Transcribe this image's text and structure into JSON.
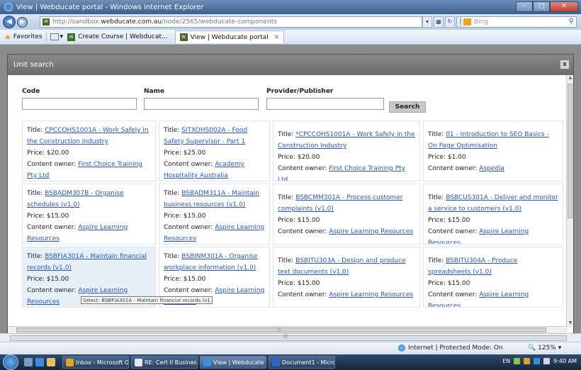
{
  "window": {
    "title": "View | Webducate portal - Windows Internet Explorer",
    "url_prefix": "http://sandbox.",
    "url_host": "webducate.com.au",
    "url_path": "/node/2565/webducate-components",
    "search_engine": "Bing"
  },
  "favorites": {
    "label": "Favorites",
    "tabs": [
      {
        "label": "Create Course | Webducat...",
        "active": false
      },
      {
        "label": "View | Webducate portal",
        "active": true
      }
    ]
  },
  "dialog": {
    "title": "Unit search",
    "close_label": "x",
    "form": {
      "code_label": "Code",
      "name_label": "Name",
      "provider_label": "Provider/Publisher",
      "code_value": "",
      "name_value": "",
      "provider_value": "",
      "search_label": "Search"
    },
    "field_labels": {
      "title": "Title: ",
      "price": "Price: ",
      "owner": "Content owner: "
    },
    "rows": [
      [
        {
          "title": "CPCCOHS1001A - Work Safely in the Construction Industry",
          "price": "$20.00",
          "owner": "First Choice Training Pty Ltd"
        },
        {
          "title": "SITXOHS002A - Food Safety Supervisor - Part 1",
          "price": "$25.00",
          "owner": "Academy Hospitality Australia"
        },
        {
          "title": "*CPCCOHS1001A - Work Safely in the Construction Industry",
          "price": "$20.00",
          "owner": "First Choice Training Pty Ltd"
        },
        {
          "title": "01 - Introduction to SEO Basics - On Page Optimisation",
          "price": "$1.00",
          "owner": "Aspedia"
        }
      ],
      [
        {
          "title": "BSBADM307B - Organise schedules (v1.0)",
          "price": "$15.00",
          "owner": "Aspire Learning Resources"
        },
        {
          "title": "BSBADM311A - Maintain business resources (v1.0)",
          "price": "$15.00",
          "owner": "Aspire Learning Resources"
        },
        {
          "title": "BSBCMM301A - Process customer complaints (v1.0)",
          "price": "$15.00",
          "owner": "Aspire Learning Resources"
        },
        {
          "title": "BSBCUS301A - Deliver and monitor a service to customers (v1.0)",
          "price": "$15.00",
          "owner": "Aspire Learning Resources"
        }
      ],
      [
        {
          "title": "BSBFIA301A - Maintain financial records (v1.0)",
          "price": "$15.00",
          "owner": "Aspire Learning Resources"
        },
        {
          "title": "BSBINM301A - Organise workplace information (v1.0)",
          "price": "$15.00",
          "owner": "Aspire Learning Resources"
        },
        {
          "title": "BSBITU303A - Design and produce text documents (v1.0)",
          "price": "$15.00",
          "owner": "Aspire Learning Resources"
        },
        {
          "title": "BSBITU304A - Produce spreadsheets (v1.0)",
          "price": "$15.00",
          "owner": "Aspire Learning Resources"
        }
      ]
    ],
    "tooltip": "Select: BSBFIA301A - Maintain financial records (v1.0)"
  },
  "status": {
    "zone": "Internet | Protected Mode: On",
    "zoom": "125%"
  },
  "taskbar": {
    "items": [
      {
        "label": "Inbox - Microsoft O...",
        "color": "#e8a21e",
        "active": false
      },
      {
        "label": "RE: Cert II Business ...",
        "color": "#e8e8e8",
        "active": false
      },
      {
        "label": "View | Webducate p...",
        "color": "#3c8ee0",
        "active": true
      },
      {
        "label": "Document1 - Micro...",
        "color": "#2f66c4",
        "active": false
      }
    ],
    "lang": "EN",
    "clock": "9:40 AM"
  }
}
